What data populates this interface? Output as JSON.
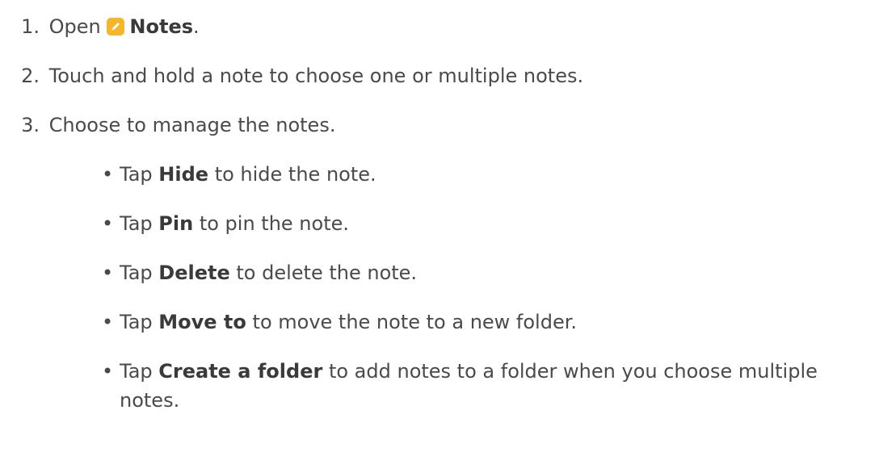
{
  "steps": [
    {
      "num": "1.",
      "pre": "Open",
      "bold": "Notes",
      "post": "."
    },
    {
      "num": "2.",
      "text": "Touch and hold a note to choose one or multiple notes."
    },
    {
      "num": "3.",
      "text": "Choose to manage the notes."
    }
  ],
  "bullets": [
    {
      "pre": "Tap",
      "bold": "Hide",
      "post": "to hide the note."
    },
    {
      "pre": "Tap",
      "bold": "Pin",
      "post": "to pin the note."
    },
    {
      "pre": "Tap",
      "bold": "Delete",
      "post": "to delete the note."
    },
    {
      "pre": "Tap",
      "bold": "Move to",
      "post": "to move the note to a new folder."
    },
    {
      "pre": "Tap",
      "bold": "Create a folder",
      "post": "to add notes to a folder when you choose multiple notes."
    }
  ],
  "bullet_glyph": "•",
  "icons": {
    "notes_app": "notes-app-icon",
    "accent": "#f7b52a"
  }
}
